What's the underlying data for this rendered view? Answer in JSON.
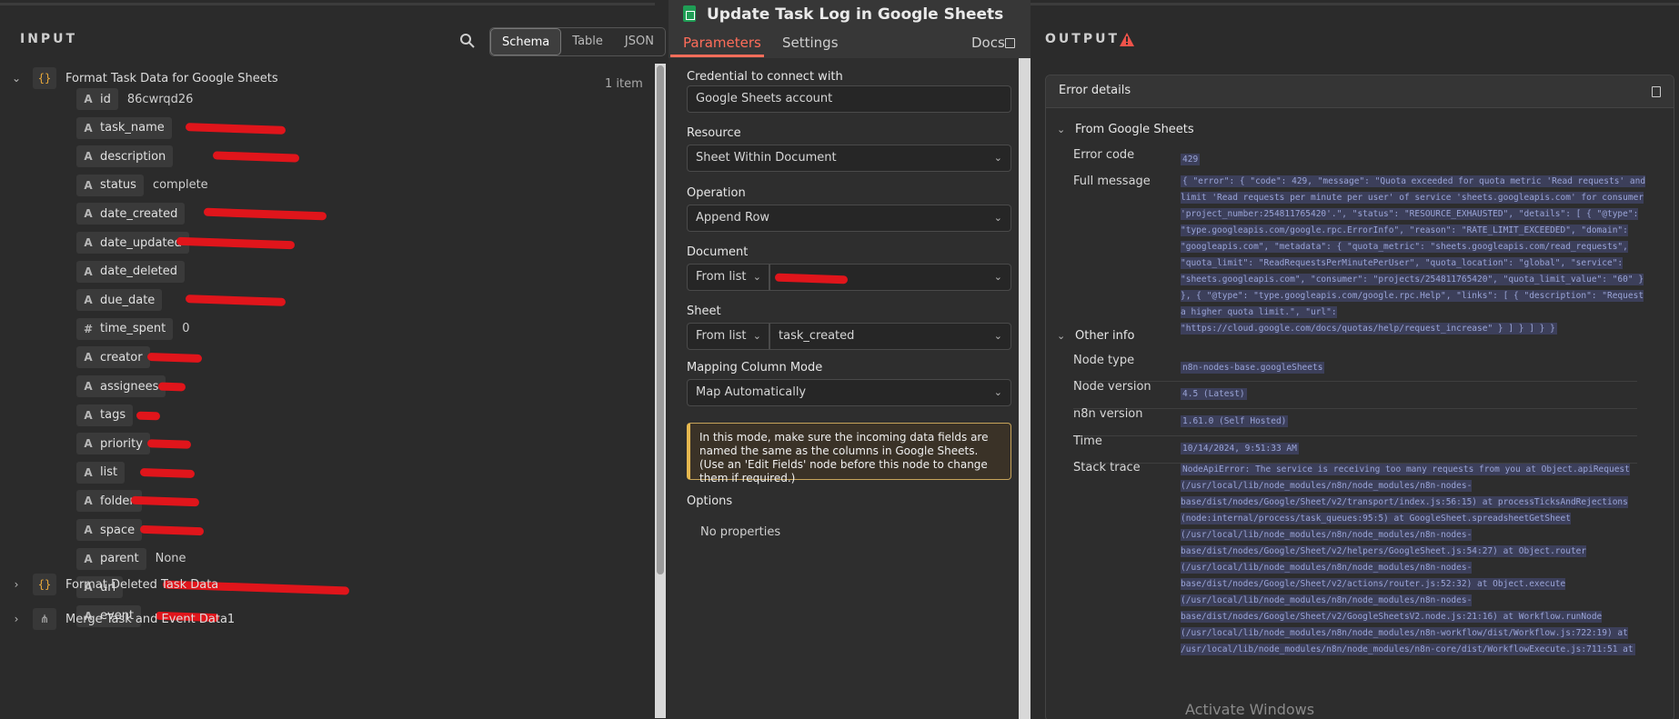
{
  "input": {
    "title": "INPUT",
    "views": [
      "Schema",
      "Table",
      "JSON"
    ],
    "active_view": "Schema",
    "item_count": "1 item",
    "group_main": "Format Task Data for Google Sheets",
    "fields": [
      {
        "type": "A",
        "name": "id",
        "value": "86cwrqd26"
      },
      {
        "type": "A",
        "name": "task_name",
        "value": ""
      },
      {
        "type": "A",
        "name": "description",
        "value": ""
      },
      {
        "type": "A",
        "name": "status",
        "value": "complete"
      },
      {
        "type": "A",
        "name": "date_created",
        "value": ""
      },
      {
        "type": "A",
        "name": "date_updated",
        "value": ""
      },
      {
        "type": "A",
        "name": "date_deleted",
        "value": ""
      },
      {
        "type": "A",
        "name": "due_date",
        "value": ""
      },
      {
        "type": "#",
        "name": "time_spent",
        "value": "0"
      },
      {
        "type": "A",
        "name": "creator",
        "value": ""
      },
      {
        "type": "A",
        "name": "assignees",
        "value": ""
      },
      {
        "type": "A",
        "name": "tags",
        "value": ""
      },
      {
        "type": "A",
        "name": "priority",
        "value": ""
      },
      {
        "type": "A",
        "name": "list",
        "value": ""
      },
      {
        "type": "A",
        "name": "folder",
        "value": ""
      },
      {
        "type": "A",
        "name": "space",
        "value": ""
      },
      {
        "type": "A",
        "name": "parent",
        "value": "None"
      },
      {
        "type": "A",
        "name": "url",
        "value": ""
      },
      {
        "type": "A",
        "name": "event",
        "value": ""
      }
    ],
    "group_deleted": "Format Deleted Task Data",
    "group_merge": "Merge Task and Event Data1"
  },
  "node": {
    "title": "Update Task Log in Google Sheets",
    "tabs": {
      "parameters": "Parameters",
      "settings": "Settings",
      "docs": "Docs"
    },
    "credential_label": "Credential to connect with",
    "credential_value": "Google Sheets account",
    "resource_label": "Resource",
    "resource_value": "Sheet Within Document",
    "operation_label": "Operation",
    "operation_value": "Append Row",
    "document_label": "Document",
    "document_mode": "From list",
    "document_value": "",
    "sheet_label": "Sheet",
    "sheet_mode": "From list",
    "sheet_value": "task_created",
    "mapping_label": "Mapping Column Mode",
    "mapping_value": "Map Automatically",
    "notice": "In this mode, make sure the incoming data fields are named the same as the columns in Google Sheets. (Use an 'Edit Fields' node before this node to change them if required.)",
    "options_label": "Options",
    "no_properties": "No properties"
  },
  "output": {
    "title": "OUTPUT",
    "error_details_label": "Error details",
    "section_from": "From Google Sheets",
    "error_code_label": "Error code",
    "error_code": "429",
    "full_message_label": "Full message",
    "full_message": "{ \"error\": { \"code\": 429, \"message\": \"Quota exceeded for quota metric 'Read requests' and limit 'Read requests per minute per user' of service 'sheets.googleapis.com' for consumer 'project_number:254811765420'.\", \"status\": \"RESOURCE_EXHAUSTED\", \"details\": [ { \"@type\": \"type.googleapis.com/google.rpc.ErrorInfo\", \"reason\": \"RATE_LIMIT_EXCEEDED\", \"domain\": \"googleapis.com\", \"metadata\": { \"quota_metric\": \"sheets.googleapis.com/read_requests\", \"quota_limit\": \"ReadRequestsPerMinutePerUser\", \"quota_location\": \"global\", \"service\": \"sheets.googleapis.com\", \"consumer\": \"projects/254811765420\", \"quota_limit_value\": \"60\" } }, { \"@type\": \"type.googleapis.com/google.rpc.Help\", \"links\": [ { \"description\": \"Request a higher quota limit.\", \"url\": \"https://cloud.google.com/docs/quotas/help/request_increase\" } ] } ] } }",
    "section_other": "Other info",
    "node_type_label": "Node type",
    "node_type": "n8n-nodes-base.googleSheets",
    "node_version_label": "Node version",
    "node_version": "4.5 (Latest)",
    "n8n_version_label": "n8n version",
    "n8n_version": "1.61.0 (Self Hosted)",
    "time_label": "Time",
    "time": "10/14/2024, 9:51:33 AM",
    "stack_trace_label": "Stack trace",
    "stack_trace": "NodeApiError: The service is receiving too many requests from you at Object.apiRequest (/usr/local/lib/node_modules/n8n/node_modules/n8n-nodes-base/dist/nodes/Google/Sheet/v2/transport/index.js:56:15) at processTicksAndRejections (node:internal/process/task_queues:95:5) at GoogleSheet.spreadsheetGetSheet (/usr/local/lib/node_modules/n8n/node_modules/n8n-nodes-base/dist/nodes/Google/Sheet/v2/helpers/GoogleSheet.js:54:27) at Object.router (/usr/local/lib/node_modules/n8n/node_modules/n8n-nodes-base/dist/nodes/Google/Sheet/v2/actions/router.js:52:32) at Object.execute (/usr/local/lib/node_modules/n8n/node_modules/n8n-nodes-base/dist/nodes/Google/Sheet/v2/GoogleSheetsV2.node.js:21:16) at Workflow.runNode (/usr/local/lib/node_modules/n8n/node_modules/n8n-workflow/dist/Workflow.js:722:19) at /usr/local/lib/node_modules/n8n/node_modules/n8n-core/dist/WorkflowExecute.js:711:51 at"
  },
  "watermark": "Activate Windows",
  "colors": {
    "accent": "#ff6d5a",
    "error": "#f0534a",
    "code": "#9aa4d6"
  }
}
